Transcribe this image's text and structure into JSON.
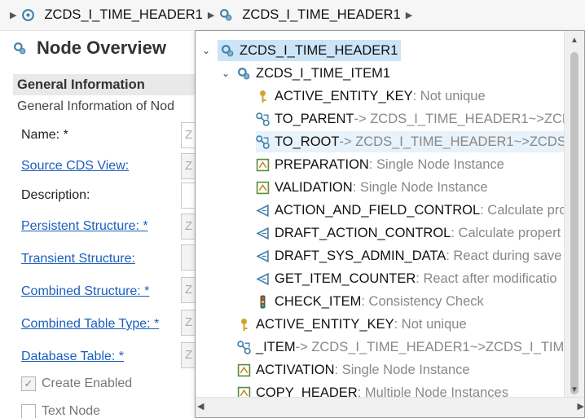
{
  "breadcrumb": {
    "items": [
      {
        "label": "ZCDS_I_TIME_HEADER1"
      },
      {
        "label": "ZCDS_I_TIME_HEADER1"
      }
    ]
  },
  "editor": {
    "title": "Node Overview",
    "section": {
      "heading": "General Information",
      "description": "General Information of Nod"
    },
    "fields": {
      "name": "Name: *",
      "source_cds_view": "Source CDS View:",
      "description": "Description:",
      "persistent_structure": "Persistent Structure: *",
      "transient_structure": "Transient Structure:",
      "combined_structure": "Combined Structure: *",
      "combined_table_type": "Combined Table Type: *",
      "database_table": "Database Table: *"
    },
    "field_stubs": {
      "name": "Z",
      "source_cds_view": "Z",
      "persistent_structure": "Z",
      "combined_structure": "Z",
      "combined_table_type": "Z",
      "database_table": "Z"
    },
    "checkboxes": {
      "create_enabled": {
        "label": "Create Enabled",
        "checked": true
      },
      "text_node": {
        "label": "Text Node",
        "checked": false
      }
    }
  },
  "tree": {
    "root": {
      "name": "ZCDS_I_TIME_HEADER1",
      "icon": "bo-node-icon"
    },
    "item1": {
      "name": "ZCDS_I_TIME_ITEM1",
      "icon": "bo-node-icon"
    },
    "rows": [
      {
        "name": "ACTIVE_ENTITY_KEY",
        "desc": " : Not unique",
        "icon": "key-icon"
      },
      {
        "name": "TO_PARENT",
        "desc": " -> ZCDS_I_TIME_HEADER1~>ZCD",
        "icon": "association-icon"
      },
      {
        "name": "TO_ROOT",
        "desc": " -> ZCDS_I_TIME_HEADER1~>ZCDS",
        "icon": "association-icon"
      },
      {
        "name": "PREPARATION",
        "desc": " : Single Node Instance",
        "icon": "determination-icon"
      },
      {
        "name": "VALIDATION",
        "desc": " : Single Node Instance",
        "icon": "determination-icon"
      },
      {
        "name": "ACTION_AND_FIELD_CONTROL",
        "desc": " : Calculate pro",
        "icon": "action-icon"
      },
      {
        "name": "DRAFT_ACTION_CONTROL",
        "desc": " : Calculate propert",
        "icon": "action-icon"
      },
      {
        "name": "DRAFT_SYS_ADMIN_DATA",
        "desc": " : React during save",
        "icon": "action-icon"
      },
      {
        "name": "GET_ITEM_COUNTER",
        "desc": " : React after modificatio",
        "icon": "action-icon"
      },
      {
        "name": "CHECK_ITEM",
        "desc": " : Consistency Check",
        "icon": "traffic-light-icon"
      }
    ],
    "root_rows": [
      {
        "name": "ACTIVE_ENTITY_KEY",
        "desc": " : Not unique",
        "icon": "key-icon"
      },
      {
        "name": "_ITEM",
        "desc": " -> ZCDS_I_TIME_HEADER1~>ZCDS_I_TIM",
        "icon": "association-icon"
      },
      {
        "name": "ACTIVATION",
        "desc": " : Single Node Instance",
        "icon": "determination-icon"
      },
      {
        "name": "COPY_HEADER",
        "desc": " : Multiple Node Instances",
        "icon": "determination-icon"
      }
    ]
  },
  "colors": {
    "link": "#1b5fbd",
    "selection": "#cce4f7",
    "hover": "#e8f2fb",
    "key_icon": "#d1a52a",
    "node_icon": "#3f7fa8"
  }
}
